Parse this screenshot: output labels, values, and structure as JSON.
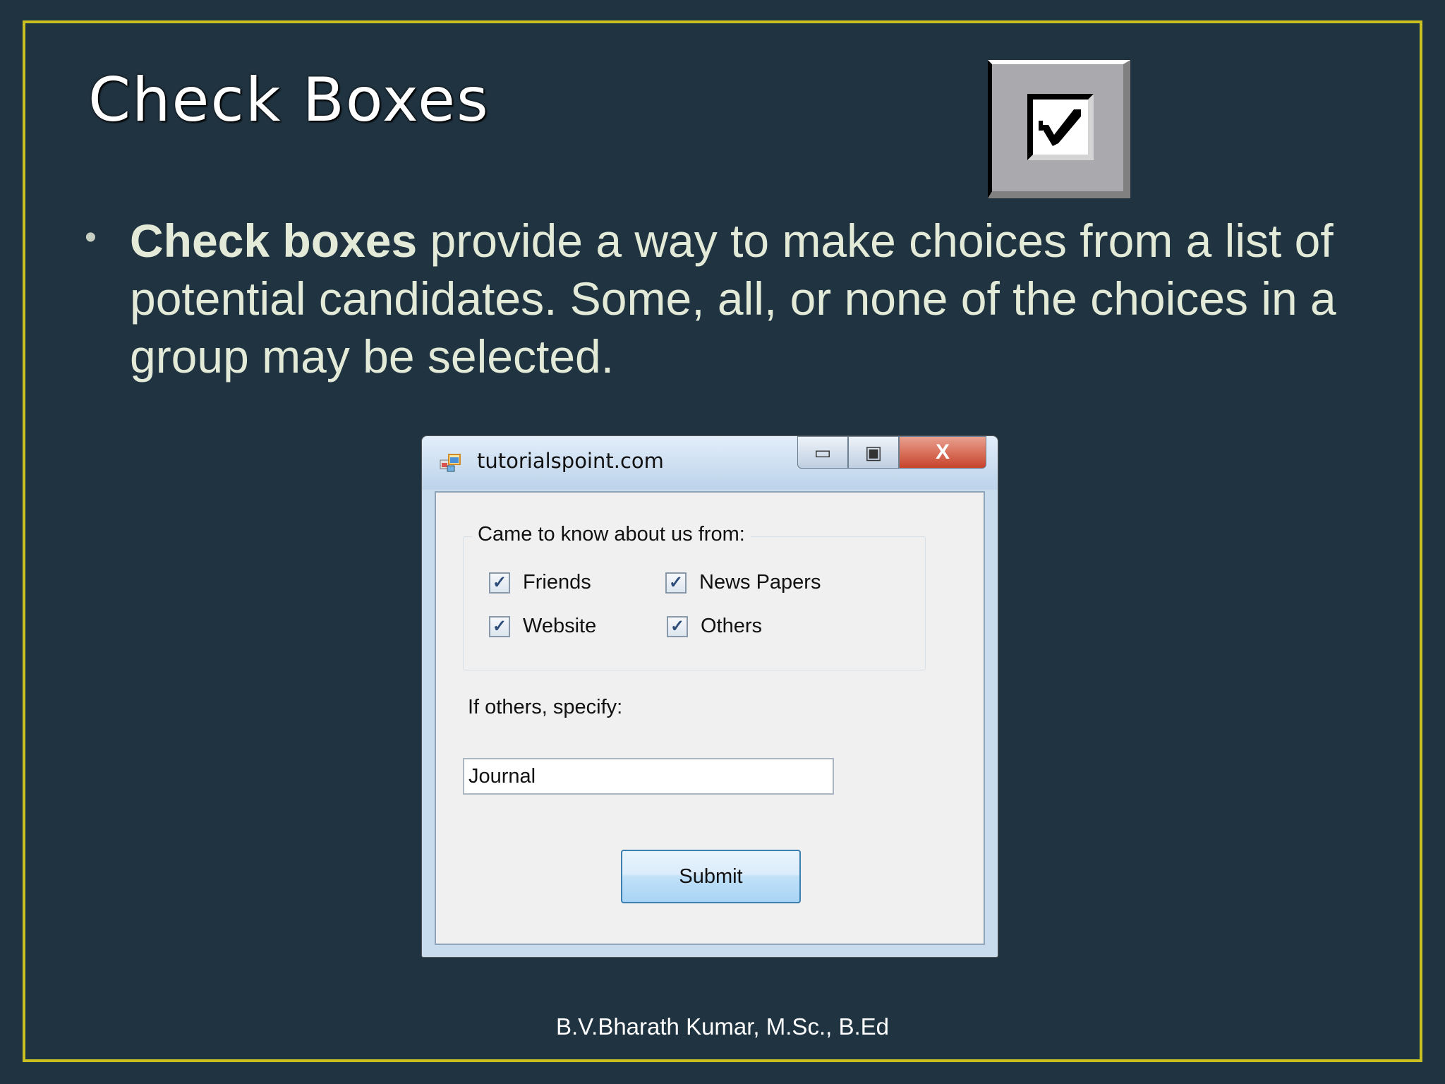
{
  "slide": {
    "title": "Check Boxes",
    "bullet": {
      "bold": "Check boxes",
      "rest": " provide a way to make choices from a list of potential candidates. Some, all, or none of the choices in a group may be selected."
    },
    "footer": "B.V.Bharath Kumar, M.Sc., B.Ed"
  },
  "window": {
    "title": "tutorialspoint.com",
    "minimize": "▭",
    "maximize": "▣",
    "close": "X",
    "group_label": "Came to know about us from:",
    "checkboxes": [
      {
        "label": "Friends",
        "checked": true
      },
      {
        "label": "News Papers",
        "checked": true
      },
      {
        "label": "Website",
        "checked": true
      },
      {
        "label": "Others",
        "checked": true
      }
    ],
    "check_glyph": "✓",
    "specify_label": "If others, specify:",
    "specify_value": "Journal",
    "submit_label": "Submit"
  },
  "colors": {
    "background": "#203340",
    "frame": "#c9c021",
    "text": "#e3ead7"
  }
}
